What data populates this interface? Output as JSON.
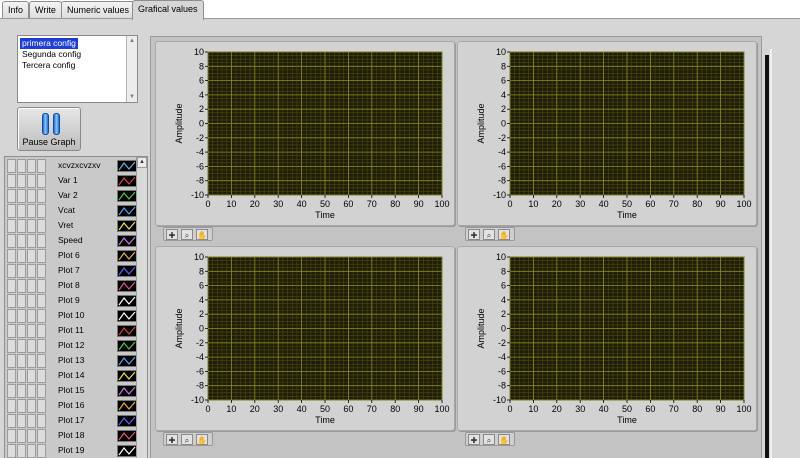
{
  "tabs": [
    "Info",
    "Write",
    "Numeric values",
    "Grafical values"
  ],
  "active_tab": 3,
  "config_list": {
    "items": [
      "primera config",
      "Segunda config",
      "Tercera config"
    ],
    "selected": 0
  },
  "pause_button": {
    "label": "Pause Graph"
  },
  "legend": {
    "items": [
      {
        "label": "xcvzxcvzxv",
        "color": "#58b8e8"
      },
      {
        "label": "Var 1",
        "color": "#e04040"
      },
      {
        "label": "Var 2",
        "color": "#40d040"
      },
      {
        "label": "Vcat",
        "color": "#4aa8ff"
      },
      {
        "label": "Vret",
        "color": "#e8e840"
      },
      {
        "label": "Speed",
        "color": "#c878e8"
      },
      {
        "label": "Plot 6",
        "color": "#e8b030"
      },
      {
        "label": "Plot 7",
        "color": "#6060ff"
      },
      {
        "label": "Plot 8",
        "color": "#e85090"
      },
      {
        "label": "Plot 9",
        "color": "#ffffff"
      },
      {
        "label": "Plot 10",
        "color": "#ffffff"
      },
      {
        "label": "Plot 11",
        "color": "#e04040"
      },
      {
        "label": "Plot 12",
        "color": "#40d040"
      },
      {
        "label": "Plot 13",
        "color": "#4aa8ff"
      },
      {
        "label": "Plot 14",
        "color": "#e8e840"
      },
      {
        "label": "Plot 15",
        "color": "#c878e8"
      },
      {
        "label": "Plot 16",
        "color": "#e8b030"
      },
      {
        "label": "Plot 17",
        "color": "#6060ff"
      },
      {
        "label": "Plot 18",
        "color": "#e85090"
      },
      {
        "label": "Plot 19",
        "color": "#ffffff"
      }
    ]
  },
  "graph_style": {
    "plot_bg": "#1e1e08",
    "grid_color": "#8c8c18",
    "minor_grid_color": "#4a4a10"
  },
  "chart_data": [
    {
      "type": "line",
      "xlabel": "Time",
      "ylabel": "Amplitude",
      "xlim": [
        0,
        100
      ],
      "ylim": [
        -10,
        10
      ],
      "xticks": [
        "0",
        "10",
        "20",
        "30",
        "40",
        "50",
        "60",
        "70",
        "80",
        "90",
        "100"
      ],
      "yticks": [
        "10",
        "8",
        "6",
        "4",
        "2",
        "0",
        "-2",
        "-4",
        "-6",
        "-8",
        "-10"
      ],
      "series": [],
      "grid": true
    },
    {
      "type": "line",
      "xlabel": "Time",
      "ylabel": "Amplitude",
      "xlim": [
        0,
        100
      ],
      "ylim": [
        -10,
        10
      ],
      "xticks": [
        "0",
        "10",
        "20",
        "30",
        "40",
        "50",
        "60",
        "70",
        "80",
        "90",
        "100"
      ],
      "yticks": [
        "10",
        "8",
        "6",
        "4",
        "2",
        "0",
        "-2",
        "-4",
        "-6",
        "-8",
        "-10"
      ],
      "series": [],
      "grid": true
    },
    {
      "type": "line",
      "xlabel": "Time",
      "ylabel": "Amplitude",
      "xlim": [
        0,
        100
      ],
      "ylim": [
        -10,
        10
      ],
      "xticks": [
        "0",
        "10",
        "20",
        "30",
        "40",
        "50",
        "60",
        "70",
        "80",
        "90",
        "100"
      ],
      "yticks": [
        "10",
        "8",
        "6",
        "4",
        "2",
        "0",
        "-2",
        "-4",
        "-6",
        "-8",
        "-10"
      ],
      "series": [],
      "grid": true
    },
    {
      "type": "line",
      "xlabel": "Time",
      "ylabel": "Amplitude",
      "xlim": [
        0,
        100
      ],
      "ylim": [
        -10,
        10
      ],
      "xticks": [
        "0",
        "10",
        "20",
        "30",
        "40",
        "50",
        "60",
        "70",
        "80",
        "90",
        "100"
      ],
      "yticks": [
        "10",
        "8",
        "6",
        "4",
        "2",
        "0",
        "-2",
        "-4",
        "-6",
        "-8",
        "-10"
      ],
      "series": [],
      "grid": true
    }
  ],
  "graph_palette": {
    "icons": [
      "crosshair-icon",
      "zoom-icon",
      "pan-hand-icon"
    ]
  }
}
